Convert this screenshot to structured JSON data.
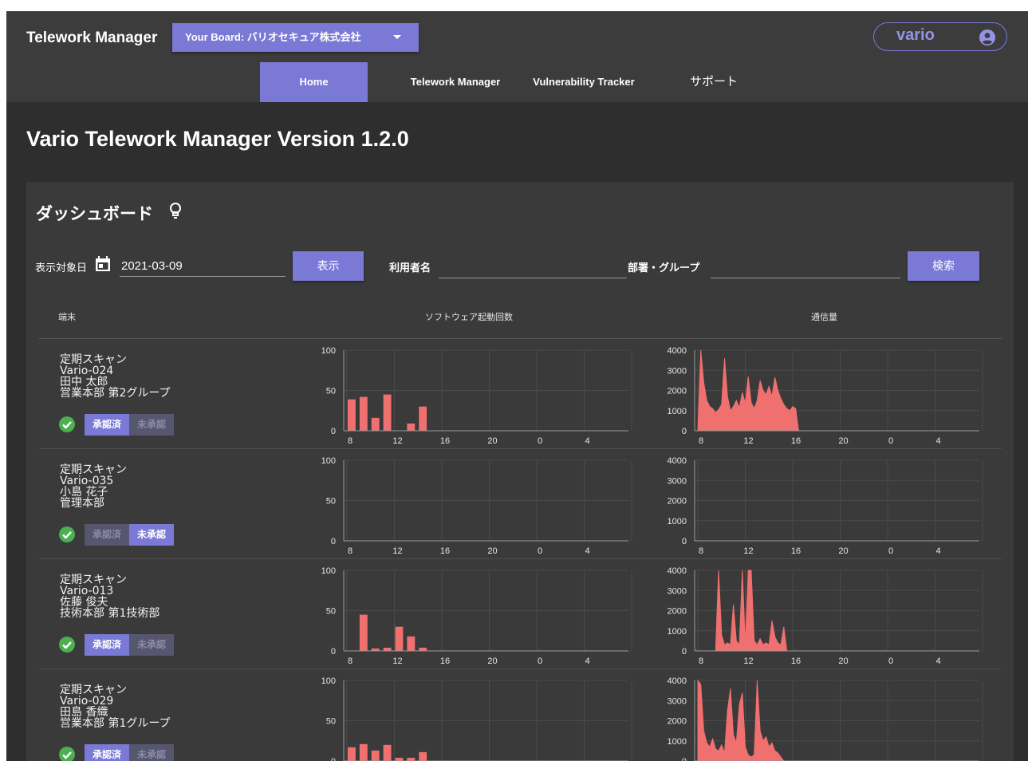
{
  "header": {
    "app_title": "Telework Manager",
    "board_selector": "Your Board: バリオセキュア株式会社",
    "user": "vario",
    "user_icon": "account-circle-icon"
  },
  "nav": [
    {
      "label": "Home",
      "active": true
    },
    {
      "label": "Telework Manager",
      "active": false
    },
    {
      "label": "Vulnerability Tracker",
      "active": false
    },
    {
      "label": "サポート",
      "active": false
    }
  ],
  "page_title": "Vario Telework Manager Version 1.2.0",
  "dashboard": {
    "title": "ダッシュボード",
    "title_icon": "lightbulb-icon",
    "date_label": "表示対象日",
    "date_icon": "calendar-icon",
    "date_value": "2021-03-09",
    "show_button": "表示",
    "user_label": "利用者名",
    "user_value": "",
    "dept_label": "部署・グループ",
    "dept_value": "",
    "search_button": "検索",
    "columns": {
      "device": "端末",
      "software": "ソフトウェア起動回数",
      "traffic": "通信量"
    },
    "approved_label": "承認済",
    "unapproved_label": "未承認"
  },
  "colors": {
    "accent": "#7b79d6",
    "chart_fill": "#f07070",
    "ok_green": "#4caf50"
  },
  "chart_data": [
    {
      "type": "bar",
      "title": "ソフトウェア起動回数 Vario-024",
      "categories": [
        "8",
        "9",
        "10",
        "11",
        "12",
        "13",
        "14",
        "15",
        "16",
        "17",
        "18",
        "19",
        "20",
        "21",
        "22",
        "23",
        "0",
        "1",
        "2",
        "3",
        "4",
        "5",
        "6",
        "7"
      ],
      "values": [
        39,
        42,
        16,
        45,
        0,
        9,
        30,
        0,
        0,
        0,
        0,
        0,
        0,
        0,
        0,
        0,
        0,
        0,
        0,
        0,
        0,
        0,
        0,
        0
      ],
      "ylim": [
        0,
        100
      ],
      "yticks": [
        0,
        50,
        100
      ],
      "xticks": [
        "8",
        "12",
        "16",
        "20",
        "0",
        "4"
      ]
    },
    {
      "type": "area",
      "title": "通信量 Vario-024",
      "x_start_hour": 8,
      "step_min": 15,
      "values": [
        0,
        4000,
        2400,
        1500,
        1200,
        1100,
        900,
        1050,
        1300,
        3600,
        1700,
        1000,
        1200,
        1500,
        1150,
        1900,
        1350,
        2700,
        1400,
        1100,
        1500,
        2500,
        2000,
        1800,
        2200,
        1700,
        2650,
        2000,
        1600,
        1300,
        1100,
        1000,
        1200,
        1100,
        0
      ],
      "ylim": [
        0,
        4000
      ],
      "yticks": [
        0,
        1000,
        2000,
        3000,
        4000
      ],
      "xticks": [
        "8",
        "12",
        "16",
        "20",
        "0",
        "4"
      ]
    },
    {
      "type": "bar",
      "title": "ソフトウェア起動回数 Vario-035",
      "categories": [
        "8",
        "9",
        "10",
        "11",
        "12",
        "13",
        "14",
        "15",
        "16",
        "17",
        "18",
        "19",
        "20",
        "21",
        "22",
        "23",
        "0",
        "1",
        "2",
        "3",
        "4",
        "5",
        "6",
        "7"
      ],
      "values": [
        0,
        0,
        0,
        0,
        0,
        0,
        0,
        0,
        0,
        0,
        0,
        0,
        0,
        0,
        0,
        0,
        0,
        0,
        0,
        0,
        0,
        0,
        0,
        0
      ],
      "ylim": [
        0,
        100
      ],
      "yticks": [
        0,
        50,
        100
      ],
      "xticks": [
        "8",
        "12",
        "16",
        "20",
        "0",
        "4"
      ]
    },
    {
      "type": "area",
      "title": "通信量 Vario-035",
      "x_start_hour": 8,
      "step_min": 15,
      "values": [
        0,
        0,
        0,
        0,
        0,
        0,
        0,
        0,
        0,
        0,
        0,
        0,
        0,
        0,
        0,
        0,
        0,
        0,
        0,
        0,
        0,
        0,
        0,
        0,
        0,
        0,
        0,
        0,
        0,
        0,
        0,
        0,
        0,
        0,
        0
      ],
      "ylim": [
        0,
        4000
      ],
      "yticks": [
        0,
        1000,
        2000,
        3000,
        4000
      ],
      "xticks": [
        "8",
        "12",
        "16",
        "20",
        "0",
        "4"
      ]
    },
    {
      "type": "bar",
      "title": "ソフトウェア起動回数 Vario-013",
      "categories": [
        "8",
        "9",
        "10",
        "11",
        "12",
        "13",
        "14",
        "15",
        "16",
        "17",
        "18",
        "19",
        "20",
        "21",
        "22",
        "23",
        "0",
        "1",
        "2",
        "3",
        "4",
        "5",
        "6",
        "7"
      ],
      "values": [
        0,
        45,
        3,
        4,
        30,
        18,
        4,
        0,
        0,
        0,
        0,
        0,
        0,
        0,
        0,
        0,
        0,
        0,
        0,
        0,
        0,
        0,
        0,
        0
      ],
      "ylim": [
        0,
        100
      ],
      "yticks": [
        0,
        50,
        100
      ],
      "xticks": [
        "8",
        "12",
        "16",
        "20",
        "0",
        "4"
      ]
    },
    {
      "type": "area",
      "title": "通信量 Vario-013",
      "x_start_hour": 8,
      "step_min": 15,
      "values": [
        0,
        0,
        0,
        0,
        0,
        0,
        0,
        4000,
        800,
        300,
        400,
        300,
        2300,
        500,
        300,
        4000,
        300,
        4000,
        4000,
        500,
        300,
        600,
        300,
        400,
        300,
        1500,
        700,
        400,
        300,
        1200,
        0,
        0,
        0,
        0,
        0
      ],
      "ylim": [
        0,
        4000
      ],
      "yticks": [
        0,
        1000,
        2000,
        3000,
        4000
      ],
      "xticks": [
        "8",
        "12",
        "16",
        "20",
        "0",
        "4"
      ]
    },
    {
      "type": "bar",
      "title": "ソフトウェア起動回数 Vario-029",
      "categories": [
        "8",
        "9",
        "10",
        "11",
        "12",
        "13",
        "14",
        "15",
        "16",
        "17",
        "18",
        "19",
        "20",
        "21",
        "22",
        "23",
        "0",
        "1",
        "2",
        "3",
        "4",
        "5",
        "6",
        "7"
      ],
      "values": [
        17,
        21,
        13,
        20,
        4,
        4,
        11,
        0,
        0,
        0,
        0,
        0,
        0,
        0,
        0,
        0,
        0,
        0,
        0,
        0,
        0,
        0,
        0,
        0
      ],
      "ylim": [
        0,
        100
      ],
      "yticks": [
        0,
        50,
        100
      ],
      "xticks": [
        "8",
        "12",
        "16",
        "20",
        "0",
        "4"
      ]
    },
    {
      "type": "area",
      "title": "通信量 Vario-029",
      "x_start_hour": 8,
      "step_min": 15,
      "values": [
        4000,
        3800,
        1500,
        900,
        700,
        1100,
        600,
        500,
        800,
        400,
        2500,
        3600,
        1300,
        900,
        2800,
        3400,
        700,
        300,
        200,
        300,
        4000,
        1500,
        1000,
        1200,
        700,
        900,
        500,
        400,
        200,
        0,
        0,
        0,
        0,
        0,
        0
      ],
      "ylim": [
        0,
        4000
      ],
      "yticks": [
        0,
        1000,
        2000,
        3000,
        4000
      ],
      "xticks": [
        "8",
        "12",
        "16",
        "20",
        "0",
        "4"
      ]
    }
  ],
  "devices": [
    {
      "scan": "定期スキャン",
      "device": "Vario-024",
      "name": "田中 太郎",
      "dept": "営業本部 第2グループ",
      "approved": true
    },
    {
      "scan": "定期スキャン",
      "device": "Vario-035",
      "name": "小島 花子",
      "dept": "管理本部",
      "approved": false
    },
    {
      "scan": "定期スキャン",
      "device": "Vario-013",
      "name": "佐藤 俊夫",
      "dept": "技術本部 第1技術部",
      "approved": true
    },
    {
      "scan": "定期スキャン",
      "device": "Vario-029",
      "name": "田島 香織",
      "dept": "営業本部 第1グループ",
      "approved": true
    }
  ]
}
